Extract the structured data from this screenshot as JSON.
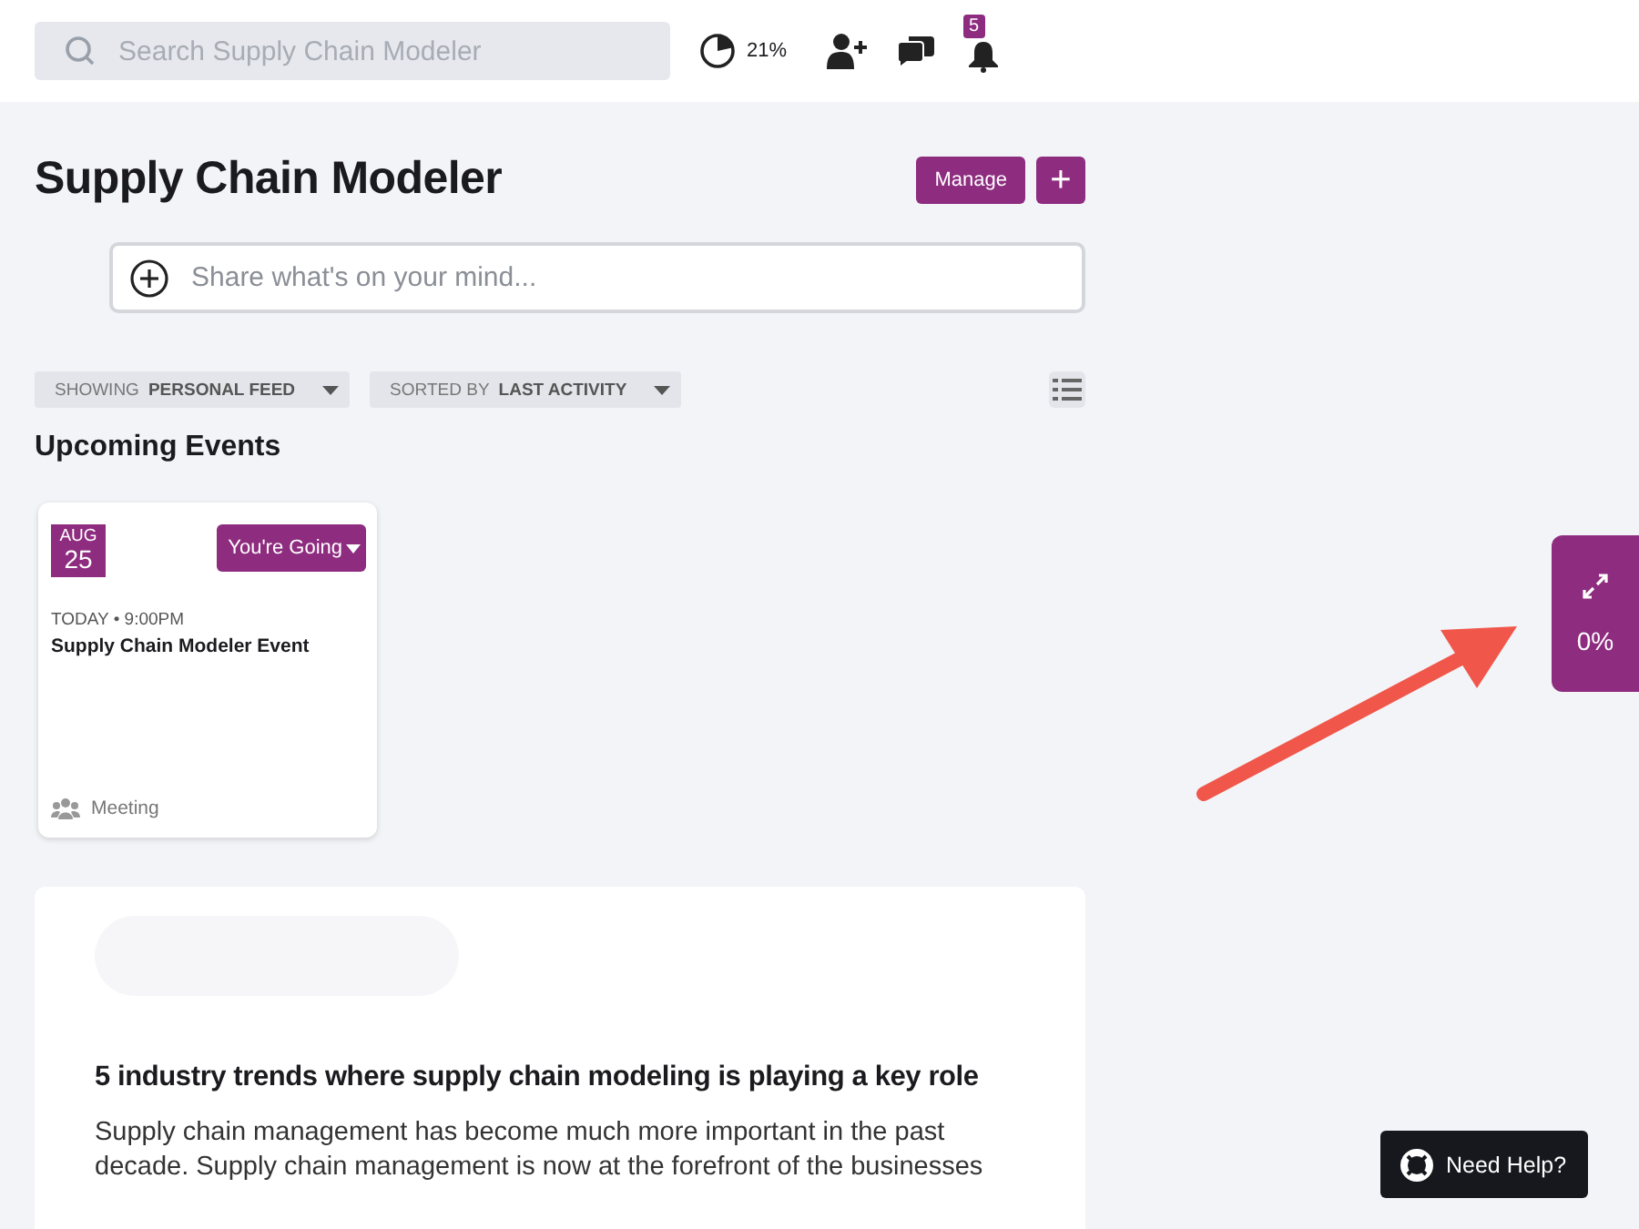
{
  "top_bar": {
    "search": {
      "placeholder": "Search Supply Chain Modeler"
    },
    "progress": {
      "reading": "21%"
    },
    "notifications": {
      "badge": "5"
    }
  },
  "header": {
    "title": "Supply Chain Modeler",
    "buttons": [
      {
        "kind": "text",
        "label": "Manage"
      },
      {
        "kind": "add",
        "label": "+"
      }
    ]
  },
  "composer": {
    "placeholder": "Share what's on your mind..."
  },
  "filters": [
    {
      "prefix": "SHOWING",
      "value": "PERSONAL FEED"
    },
    {
      "prefix": "SORTED BY",
      "value": "LAST ACTIVITY"
    }
  ],
  "events": {
    "title": "Upcoming Events",
    "items": [
      {
        "month": "AUG",
        "day": "25",
        "rsvp": "You're Going",
        "when": "TODAY • 9:00PM",
        "name": "Supply Chain Modeler Event",
        "type": "Meeting"
      }
    ]
  },
  "article": {
    "title": "5 industry trends where supply chain modeling is playing a key role",
    "body": "Supply chain management has become much more important in the past decade. Supply chain management is now at the forefront of the businesses"
  },
  "side_widget": {
    "reading": "0%"
  },
  "help_button": {
    "label": "Need Help?"
  }
}
